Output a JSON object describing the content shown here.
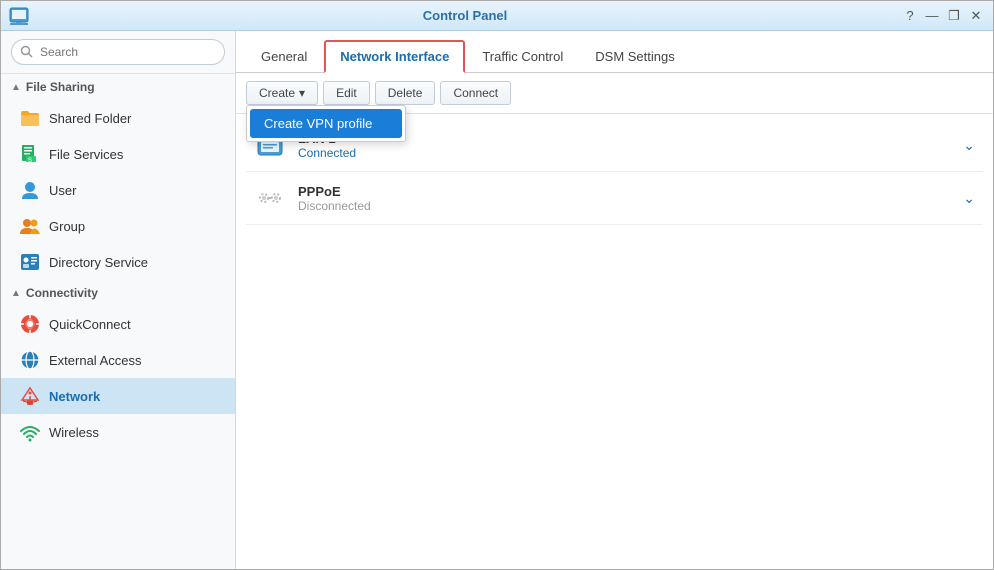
{
  "window": {
    "title": "Control Panel",
    "controls": {
      "help": "?",
      "minimize": "—",
      "maximize": "❐",
      "close": "✕"
    }
  },
  "sidebar": {
    "search": {
      "placeholder": "Search"
    },
    "sections": [
      {
        "id": "file-sharing",
        "label": "File Sharing",
        "expanded": true,
        "items": [
          {
            "id": "shared-folder",
            "label": "Shared Folder",
            "icon": "folder"
          },
          {
            "id": "file-services",
            "label": "File Services",
            "icon": "file-services"
          }
        ]
      },
      {
        "id": "user-group",
        "label": "",
        "expanded": true,
        "items": [
          {
            "id": "user",
            "label": "User",
            "icon": "user"
          },
          {
            "id": "group",
            "label": "Group",
            "icon": "group"
          },
          {
            "id": "directory-service",
            "label": "Directory Service",
            "icon": "directory"
          }
        ]
      },
      {
        "id": "connectivity",
        "label": "Connectivity",
        "expanded": true,
        "items": [
          {
            "id": "quickconnect",
            "label": "QuickConnect",
            "icon": "quickconnect"
          },
          {
            "id": "external-access",
            "label": "External Access",
            "icon": "external"
          },
          {
            "id": "network",
            "label": "Network",
            "icon": "network",
            "active": true
          },
          {
            "id": "wireless",
            "label": "Wireless",
            "icon": "wireless"
          }
        ]
      }
    ]
  },
  "main": {
    "tabs": [
      {
        "id": "general",
        "label": "General"
      },
      {
        "id": "network-interface",
        "label": "Network Interface",
        "active": true
      },
      {
        "id": "traffic-control",
        "label": "Traffic Control"
      },
      {
        "id": "dsm-settings",
        "label": "DSM Settings"
      }
    ],
    "toolbar": {
      "create_label": "Create",
      "edit_label": "Edit",
      "delete_label": "Delete",
      "connect_label": "Connect",
      "dropdown_items": [
        {
          "id": "create-vpn",
          "label": "Create VPN profile"
        }
      ]
    },
    "network_items": [
      {
        "id": "lan1",
        "name": "LAN 1",
        "status": "Connected",
        "status_type": "connected"
      },
      {
        "id": "pppoe",
        "name": "PPPoE",
        "status": "Disconnected",
        "status_type": "disconnected"
      }
    ]
  }
}
